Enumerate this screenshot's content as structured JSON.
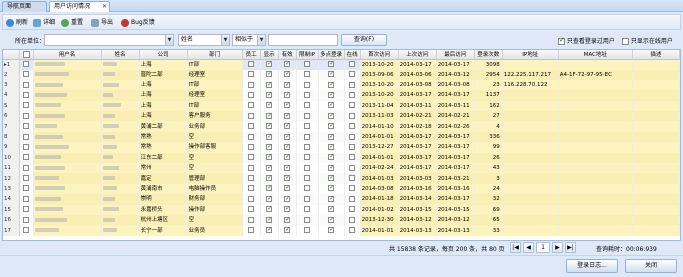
{
  "tabs": [
    {
      "label": "导航页面"
    },
    {
      "label": "用户访问情况"
    }
  ],
  "toolbar": {
    "refresh": "刷新",
    "detail": "详细",
    "reset": "重置",
    "export": "导出",
    "bug": "Bug反馈"
  },
  "filter": {
    "unit_label": "所在单位：",
    "field_value": "姓名",
    "op_value": "相似于",
    "query_button": "查询(F)",
    "only_logged": "只查看登录过用户",
    "only_online": "只显示在线用户"
  },
  "columns": [
    "",
    "",
    "用户名",
    "姓名",
    "公司",
    "部门",
    "员工",
    "显示",
    "有效",
    "限制IP",
    "多点登录",
    "在线",
    "首次访问",
    "上次访问",
    "最后访问",
    "登录次数",
    "IP地址",
    "MAC地址",
    "描述"
  ],
  "rows": [
    {
      "rn": "1",
      "company": "上海",
      "dept": "IT部",
      "emp": false,
      "show": true,
      "valid": true,
      "ip_limit": false,
      "multi": true,
      "online": false,
      "first": "2013-10-20",
      "last": "2014-03-17",
      "latest": "2014-03-17",
      "count": "3098",
      "ip": "",
      "mac": "",
      "desc": ""
    },
    {
      "rn": "2",
      "company": "晋陀二部",
      "dept": "经理室",
      "emp": false,
      "show": true,
      "valid": true,
      "ip_limit": false,
      "multi": true,
      "online": false,
      "first": "2013-09-06",
      "last": "2014-03-06",
      "latest": "2014-03-12",
      "count": "2954",
      "ip": "122.225.117.217",
      "mac": "A4-1F-72-97-95-EC",
      "desc": ""
    },
    {
      "rn": "3",
      "company": "上海",
      "dept": "IT部",
      "emp": false,
      "show": true,
      "valid": true,
      "ip_limit": false,
      "multi": true,
      "online": false,
      "first": "2013-10-20",
      "last": "2014-03-08",
      "latest": "2014-03-08",
      "count": "23",
      "ip": "116.228.70.122",
      "mac": "",
      "desc": ""
    },
    {
      "rn": "4",
      "company": "上海",
      "dept": "经理室",
      "emp": false,
      "show": true,
      "valid": true,
      "ip_limit": false,
      "multi": true,
      "online": false,
      "first": "2013-10-20",
      "last": "2014-03-17",
      "latest": "2014-03-17",
      "count": "1137",
      "ip": "",
      "mac": "",
      "desc": ""
    },
    {
      "rn": "5",
      "company": "上海",
      "dept": "IT部",
      "emp": false,
      "show": true,
      "valid": true,
      "ip_limit": false,
      "multi": true,
      "online": false,
      "first": "2013-11-04",
      "last": "2014-03-11",
      "latest": "2014-03-11",
      "count": "162",
      "ip": "",
      "mac": "",
      "desc": ""
    },
    {
      "rn": "6",
      "company": "上海",
      "dept": "客户服务",
      "emp": false,
      "show": true,
      "valid": true,
      "ip_limit": false,
      "multi": true,
      "online": false,
      "first": "2013-11-03",
      "last": "2014-02-21",
      "latest": "2014-02-21",
      "count": "27",
      "ip": "",
      "mac": "",
      "desc": ""
    },
    {
      "rn": "7",
      "company": "黄浦二部",
      "dept": "业务部",
      "emp": false,
      "show": true,
      "valid": true,
      "ip_limit": false,
      "multi": true,
      "online": false,
      "first": "2014-01-10",
      "last": "2014-02-18",
      "latest": "2014-02-26",
      "count": "4",
      "ip": "",
      "mac": "",
      "desc": ""
    },
    {
      "rn": "8",
      "company": "常熟",
      "dept": "空",
      "emp": false,
      "show": true,
      "valid": true,
      "ip_limit": false,
      "multi": true,
      "online": false,
      "first": "2014-01-01",
      "last": "2014-03-17",
      "latest": "2014-03-17",
      "count": "336",
      "ip": "",
      "mac": "",
      "desc": ""
    },
    {
      "rn": "9",
      "company": "常熟",
      "dept": "操作部客服",
      "emp": false,
      "show": true,
      "valid": true,
      "ip_limit": false,
      "multi": true,
      "online": false,
      "first": "2013-12-27",
      "last": "2014-03-17",
      "latest": "2014-03-17",
      "count": "99",
      "ip": "",
      "mac": "",
      "desc": ""
    },
    {
      "rn": "10",
      "company": "江东二部",
      "dept": "空",
      "emp": false,
      "show": true,
      "valid": true,
      "ip_limit": false,
      "multi": true,
      "online": false,
      "first": "2014-01-01",
      "last": "2014-03-17",
      "latest": "2014-03-17",
      "count": "26",
      "ip": "",
      "mac": "",
      "desc": ""
    },
    {
      "rn": "11",
      "company": "常州",
      "dept": "空",
      "emp": false,
      "show": true,
      "valid": true,
      "ip_limit": false,
      "multi": true,
      "online": false,
      "first": "2014-02-24",
      "last": "2014-03-17",
      "latest": "2014-03-17",
      "count": "43",
      "ip": "",
      "mac": "",
      "desc": ""
    },
    {
      "rn": "12",
      "company": "嘉定",
      "dept": "管理部",
      "emp": false,
      "show": true,
      "valid": true,
      "ip_limit": false,
      "multi": true,
      "online": false,
      "first": "2014-01-03",
      "last": "2014-03-03",
      "latest": "2014-03-21",
      "count": "3",
      "ip": "",
      "mac": "",
      "desc": ""
    },
    {
      "rn": "13",
      "company": "黄浦南市",
      "dept": "电脑操作员",
      "emp": false,
      "show": true,
      "valid": true,
      "ip_limit": false,
      "multi": true,
      "online": false,
      "first": "2014-03-08",
      "last": "2014-03-16",
      "latest": "2014-03-16",
      "count": "24",
      "ip": "",
      "mac": "",
      "desc": ""
    },
    {
      "rn": "14",
      "company": "崇明",
      "dept": "财务部",
      "emp": false,
      "show": true,
      "valid": true,
      "ip_limit": false,
      "multi": true,
      "online": false,
      "first": "2014-01-18",
      "last": "2014-03-14",
      "latest": "2014-03-17",
      "count": "32",
      "ip": "",
      "mac": "",
      "desc": ""
    },
    {
      "rn": "15",
      "company": "永嘉桥头",
      "dept": "操作部",
      "emp": false,
      "show": true,
      "valid": true,
      "ip_limit": false,
      "multi": true,
      "online": false,
      "first": "2014-01-02",
      "last": "2014-03-15",
      "latest": "2014-03-15",
      "count": "69",
      "ip": "",
      "mac": "",
      "desc": ""
    },
    {
      "rn": "16",
      "company": "杭州上塘区",
      "dept": "空",
      "emp": false,
      "show": true,
      "valid": true,
      "ip_limit": false,
      "multi": true,
      "online": false,
      "first": "2013-12-30",
      "last": "2014-03-12",
      "latest": "2014-03-12",
      "count": "65",
      "ip": "",
      "mac": "",
      "desc": ""
    },
    {
      "rn": "17",
      "company": "长宁一部",
      "dept": "业务员",
      "emp": false,
      "show": true,
      "valid": true,
      "ip_limit": false,
      "multi": true,
      "online": false,
      "first": "2014-01-01",
      "last": "2014-03-13",
      "latest": "2014-03-13",
      "count": "33",
      "ip": "",
      "mac": "",
      "desc": ""
    }
  ],
  "pager": {
    "summary": "共 15838 条记录，每页 200 条，共 80 页",
    "page": "1",
    "time": "查询耗时：00:06:939"
  },
  "bottom": {
    "login_log": "登录日志...",
    "close": "关闭"
  }
}
